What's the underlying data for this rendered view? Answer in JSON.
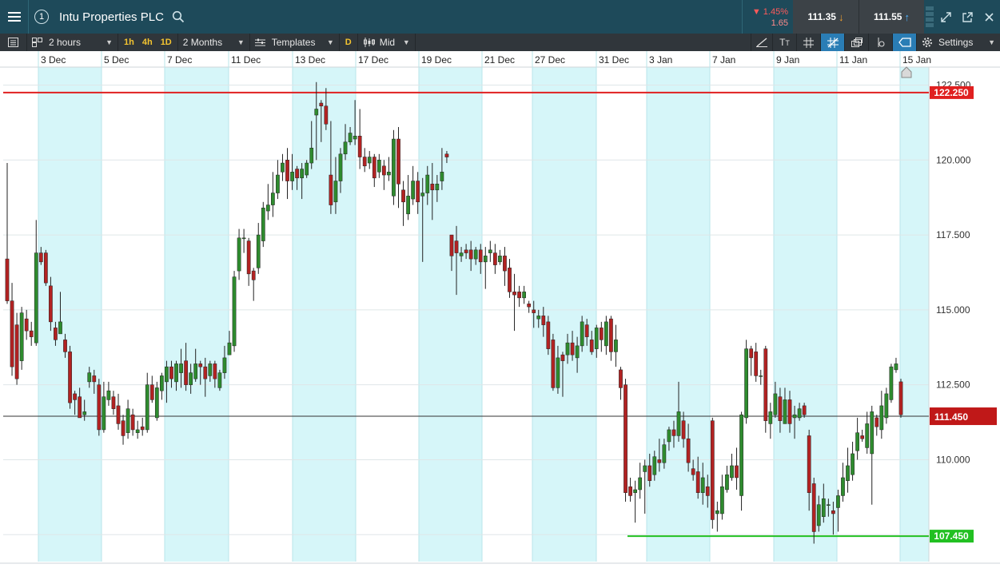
{
  "header": {
    "instrument": "Intu Properties PLC",
    "change_pct": "▼ 1.45%",
    "change_abs": "1.65",
    "sell_price": "111.35",
    "buy_price": "111.55",
    "badge_number": "1"
  },
  "toolbar": {
    "interval": "2 hours",
    "tf_1h": "1h",
    "tf_4h": "4h",
    "tf_1d": "1D",
    "range": "2 Months",
    "templates": "Templates",
    "d_label": "D",
    "price_type": "Mid",
    "settings": "Settings"
  },
  "colors": {
    "up": "#2e8b2e",
    "down": "#b22222",
    "resistance": "#e02020",
    "support": "#22c022",
    "current": "#c01818",
    "band": "#d6f6f9"
  },
  "chart_data": {
    "type": "candlestick",
    "x_labels": [
      "3 Dec",
      "5 Dec",
      "7 Dec",
      "11 Dec",
      "13 Dec",
      "17 Dec",
      "19 Dec",
      "21 Dec",
      "27 Dec",
      "31 Dec",
      "3 Jan",
      "7 Jan",
      "9 Jan",
      "11 Jan",
      "15 Jan"
    ],
    "y_ticks": [
      "122.500",
      "120.000",
      "117.500",
      "115.000",
      "112.500",
      "110.000",
      "107.500"
    ],
    "ylim": [
      106.6,
      123.1
    ],
    "resistance": {
      "value": 122.25,
      "label": "122.250"
    },
    "support": {
      "value": 107.45,
      "label": "107.450"
    },
    "current": {
      "value": 111.45,
      "label": "111.450"
    },
    "candles": [
      [
        116.7,
        115.3,
        119.9,
        115.2
      ],
      [
        115.3,
        113.1,
        115.9,
        112.8
      ],
      [
        114.5,
        112.7,
        114.9,
        112.5
      ],
      [
        113.3,
        114.9,
        115.1,
        113.0
      ],
      [
        114.7,
        114.3,
        115.0,
        114.0
      ],
      [
        114.3,
        114.1,
        114.6,
        113.8
      ],
      [
        113.9,
        116.9,
        118.0,
        113.8
      ],
      [
        116.9,
        116.6,
        117.1,
        116.5
      ],
      [
        116.9,
        115.9,
        117.0,
        115.8
      ],
      [
        115.8,
        114.6,
        116.1,
        114.3
      ],
      [
        114.4,
        114.0,
        114.6,
        113.8
      ],
      [
        114.2,
        114.6,
        115.6,
        114.3
      ],
      [
        114.0,
        113.6,
        114.2,
        113.4
      ],
      [
        113.6,
        111.9,
        113.8,
        111.7
      ],
      [
        112.2,
        112.0,
        112.3,
        111.5
      ],
      [
        112.1,
        111.4,
        112.4,
        111.4
      ],
      [
        111.5,
        111.6,
        112.0,
        111.3
      ],
      [
        112.6,
        112.9,
        113.1,
        112.4
      ],
      [
        112.8,
        112.6,
        113.0,
        112.2
      ],
      [
        112.5,
        111.0,
        112.7,
        110.8
      ],
      [
        111.0,
        112.1,
        112.6,
        110.9
      ],
      [
        112.0,
        112.3,
        112.6,
        111.8
      ],
      [
        112.1,
        111.7,
        112.3,
        111.5
      ],
      [
        111.8,
        111.2,
        112.2,
        111.0
      ],
      [
        111.3,
        110.8,
        111.5,
        110.5
      ],
      [
        110.9,
        111.7,
        112.0,
        110.7
      ],
      [
        111.5,
        111.0,
        111.7,
        110.8
      ],
      [
        110.9,
        111.0,
        111.3,
        110.7
      ],
      [
        111.1,
        111.0,
        111.4,
        110.8
      ],
      [
        111.0,
        112.5,
        112.9,
        110.9
      ],
      [
        112.5,
        112.0,
        112.8,
        111.9
      ],
      [
        111.4,
        112.4,
        112.6,
        111.3
      ],
      [
        112.3,
        112.8,
        112.9,
        112.0
      ],
      [
        112.6,
        113.1,
        113.3,
        111.9
      ],
      [
        113.1,
        112.7,
        113.3,
        112.4
      ],
      [
        112.6,
        113.2,
        113.3,
        112.3
      ],
      [
        112.9,
        113.2,
        113.7,
        112.4
      ],
      [
        113.3,
        112.5,
        113.9,
        112.3
      ],
      [
        112.5,
        112.9,
        113.2,
        112.2
      ],
      [
        112.7,
        113.2,
        113.7,
        112.6
      ],
      [
        113.2,
        113.1,
        113.3,
        112.5
      ],
      [
        113.1,
        112.7,
        113.4,
        112.1
      ],
      [
        112.8,
        113.2,
        113.3,
        112.6
      ],
      [
        113.2,
        112.7,
        113.3,
        112.4
      ],
      [
        112.4,
        112.9,
        113.0,
        112.3
      ],
      [
        112.9,
        113.4,
        113.8,
        112.7
      ],
      [
        113.5,
        113.9,
        114.3,
        113.5
      ],
      [
        113.8,
        116.1,
        116.3,
        113.6
      ],
      [
        116.3,
        117.4,
        117.7,
        116.0
      ],
      [
        117.4,
        117.4,
        117.7,
        116.9
      ],
      [
        117.3,
        116.2,
        117.4,
        115.8
      ],
      [
        116.3,
        116.0,
        116.4,
        115.3
      ],
      [
        116.4,
        117.5,
        117.9,
        116.2
      ],
      [
        117.3,
        118.4,
        118.6,
        117.1
      ],
      [
        118.3,
        118.5,
        119.2,
        118.0
      ],
      [
        118.5,
        118.9,
        119.6,
        118.1
      ],
      [
        118.9,
        119.5,
        120.0,
        118.7
      ],
      [
        119.6,
        119.9,
        120.2,
        119.3
      ],
      [
        120.0,
        119.3,
        120.4,
        118.7
      ],
      [
        119.3,
        119.6,
        120.2,
        119.0
      ],
      [
        119.7,
        119.4,
        119.8,
        119.0
      ],
      [
        119.4,
        119.7,
        119.9,
        118.7
      ],
      [
        119.5,
        119.9,
        120.0,
        119.4
      ],
      [
        119.9,
        120.4,
        121.3,
        119.7
      ],
      [
        121.5,
        121.7,
        122.6,
        120.0
      ],
      [
        121.9,
        121.8,
        122.0,
        120.6
      ],
      [
        121.8,
        121.2,
        122.4,
        121.0
      ],
      [
        119.5,
        118.5,
        121.3,
        118.2
      ],
      [
        118.6,
        119.3,
        120.1,
        118.2
      ],
      [
        119.3,
        120.2,
        120.4,
        118.9
      ],
      [
        120.2,
        120.6,
        121.2,
        120.0
      ],
      [
        120.6,
        120.9,
        121.1,
        120.5
      ],
      [
        120.7,
        120.8,
        122.0,
        120.5
      ],
      [
        120.8,
        120.1,
        121.7,
        119.7
      ],
      [
        120.1,
        119.8,
        120.4,
        119.6
      ],
      [
        119.9,
        120.1,
        120.3,
        119.7
      ],
      [
        120.1,
        119.4,
        120.2,
        119.1
      ],
      [
        119.6,
        120.0,
        120.2,
        119.4
      ],
      [
        119.8,
        119.5,
        120.0,
        119.0
      ],
      [
        119.5,
        119.6,
        120.1,
        119.3
      ],
      [
        118.8,
        120.7,
        121.0,
        118.5
      ],
      [
        120.7,
        119.2,
        121.1,
        118.4
      ],
      [
        119.0,
        118.6,
        119.3,
        117.8
      ],
      [
        118.2,
        118.8,
        119.5,
        118.0
      ],
      [
        118.7,
        119.3,
        119.8,
        118.5
      ],
      [
        119.3,
        118.6,
        119.6,
        118.2
      ],
      [
        118.8,
        118.9,
        119.4,
        116.6
      ],
      [
        118.9,
        119.5,
        119.8,
        118.5
      ],
      [
        119.2,
        119.0,
        119.9,
        118.0
      ],
      [
        119.0,
        119.2,
        119.5,
        118.6
      ],
      [
        119.3,
        119.6,
        120.4,
        119.0
      ],
      [
        120.2,
        120.1,
        120.3,
        119.9
      ],
      [
        117.5,
        116.8,
        117.5,
        116.3
      ],
      [
        117.3,
        116.9,
        117.8,
        115.5
      ],
      [
        116.8,
        116.9,
        117.1,
        116.6
      ],
      [
        117.0,
        116.9,
        117.2,
        116.7
      ],
      [
        117.0,
        116.7,
        117.3,
        116.3
      ],
      [
        116.7,
        117.0,
        117.1,
        116.5
      ],
      [
        117.0,
        116.6,
        117.2,
        116.2
      ],
      [
        116.6,
        116.8,
        117.1,
        115.7
      ],
      [
        116.9,
        117.0,
        117.3,
        116.6
      ],
      [
        116.9,
        116.5,
        117.2,
        116.2
      ],
      [
        116.6,
        116.8,
        117.0,
        116.5
      ],
      [
        116.8,
        116.3,
        117.1,
        115.8
      ],
      [
        116.4,
        115.6,
        116.7,
        115.4
      ],
      [
        115.6,
        115.5,
        116.2,
        114.3
      ],
      [
        115.6,
        115.4,
        115.8,
        115.1
      ],
      [
        115.4,
        115.6,
        115.8,
        115.2
      ],
      [
        115.2,
        115.1,
        115.3,
        114.9
      ],
      [
        115.0,
        114.9,
        115.3,
        114.4
      ],
      [
        114.7,
        114.8,
        115.0,
        114.4
      ],
      [
        114.8,
        114.5,
        115.1,
        114.1
      ],
      [
        114.6,
        113.7,
        114.8,
        113.5
      ],
      [
        114.0,
        112.4,
        114.2,
        112.3
      ],
      [
        112.4,
        113.4,
        113.8,
        112.2
      ],
      [
        113.5,
        113.3,
        113.6,
        112.1
      ],
      [
        113.5,
        113.9,
        114.2,
        113.2
      ],
      [
        113.9,
        113.5,
        114.3,
        113.3
      ],
      [
        113.4,
        113.8,
        114.1,
        112.9
      ],
      [
        113.8,
        114.6,
        114.8,
        113.6
      ],
      [
        114.5,
        114.1,
        114.7,
        113.8
      ],
      [
        114.0,
        113.6,
        114.3,
        113.5
      ],
      [
        113.7,
        114.4,
        114.5,
        113.4
      ],
      [
        114.4,
        114.0,
        114.6,
        113.6
      ],
      [
        113.8,
        114.6,
        114.8,
        113.5
      ],
      [
        114.7,
        113.6,
        114.8,
        113.3
      ],
      [
        113.6,
        114.0,
        114.5,
        113.1
      ],
      [
        113.0,
        112.4,
        113.1,
        112.0
      ],
      [
        112.5,
        108.9,
        112.7,
        108.6
      ],
      [
        109.1,
        108.8,
        109.4,
        108.6
      ],
      [
        108.9,
        109.0,
        109.3,
        107.9
      ],
      [
        109.0,
        109.4,
        109.9,
        108.7
      ],
      [
        109.6,
        109.8,
        110.0,
        108.2
      ],
      [
        109.8,
        109.3,
        110.2,
        109.1
      ],
      [
        109.5,
        110.1,
        110.3,
        109.3
      ],
      [
        110.0,
        109.9,
        110.7,
        109.6
      ],
      [
        109.9,
        110.5,
        110.7,
        109.7
      ],
      [
        110.6,
        111.0,
        111.1,
        110.3
      ],
      [
        111.0,
        110.8,
        111.3,
        110.4
      ],
      [
        110.8,
        111.6,
        112.6,
        110.6
      ],
      [
        111.3,
        110.7,
        111.6,
        110.4
      ],
      [
        110.7,
        109.9,
        111.2,
        109.6
      ],
      [
        109.7,
        109.5,
        110.0,
        109.3
      ],
      [
        109.6,
        108.9,
        110.1,
        108.7
      ],
      [
        108.9,
        109.4,
        109.9,
        108.5
      ],
      [
        109.1,
        108.8,
        109.5,
        108.4
      ],
      [
        111.3,
        108.0,
        111.4,
        107.7
      ],
      [
        108.2,
        108.3,
        108.6,
        107.6
      ],
      [
        108.2,
        109.1,
        109.5,
        108.0
      ],
      [
        109.0,
        109.5,
        109.8,
        108.9
      ],
      [
        109.4,
        109.8,
        110.2,
        109.3
      ],
      [
        109.8,
        109.4,
        110.4,
        109.0
      ],
      [
        108.8,
        111.5,
        111.6,
        108.3
      ],
      [
        111.4,
        113.7,
        114.0,
        111.2
      ],
      [
        113.7,
        113.4,
        113.8,
        112.8
      ],
      [
        113.6,
        112.8,
        113.9,
        112.6
      ],
      [
        112.8,
        112.8,
        113.0,
        112.5
      ],
      [
        113.7,
        111.3,
        113.8,
        110.9
      ],
      [
        111.2,
        111.6,
        111.9,
        110.7
      ],
      [
        111.5,
        112.2,
        112.6,
        111.4
      ],
      [
        112.1,
        111.3,
        112.4,
        110.9
      ],
      [
        111.2,
        112.0,
        112.4,
        111.2
      ],
      [
        112.0,
        111.2,
        112.3,
        110.9
      ],
      [
        111.4,
        111.5,
        111.8,
        110.7
      ],
      [
        111.4,
        111.7,
        111.9,
        111.3
      ],
      [
        111.8,
        111.5,
        111.9,
        111.4
      ],
      [
        110.8,
        108.9,
        111.0,
        108.3
      ],
      [
        109.2,
        107.6,
        109.4,
        107.2
      ],
      [
        107.8,
        108.5,
        108.8,
        107.6
      ],
      [
        108.1,
        108.7,
        109.2,
        107.9
      ],
      [
        108.5,
        108.5,
        108.7,
        108.1
      ],
      [
        108.3,
        108.2,
        108.6,
        107.5
      ],
      [
        108.4,
        108.8,
        109.0,
        107.6
      ],
      [
        108.8,
        109.4,
        109.9,
        108.6
      ],
      [
        109.3,
        109.8,
        110.4,
        108.9
      ],
      [
        109.5,
        110.2,
        110.6,
        109.3
      ],
      [
        110.3,
        110.9,
        111.4,
        110.0
      ],
      [
        110.8,
        110.7,
        111.0,
        110.6
      ],
      [
        110.4,
        111.2,
        111.6,
        110.2
      ],
      [
        110.2,
        111.6,
        111.8,
        108.5
      ],
      [
        111.4,
        111.1,
        111.5,
        110.8
      ],
      [
        111.0,
        111.8,
        112.3,
        110.7
      ],
      [
        111.4,
        112.2,
        112.4,
        111.2
      ],
      [
        112.0,
        113.1,
        113.2,
        111.9
      ],
      [
        113.0,
        113.2,
        113.4,
        112.9
      ],
      [
        112.6,
        111.5,
        112.7,
        111.4
      ]
    ]
  }
}
